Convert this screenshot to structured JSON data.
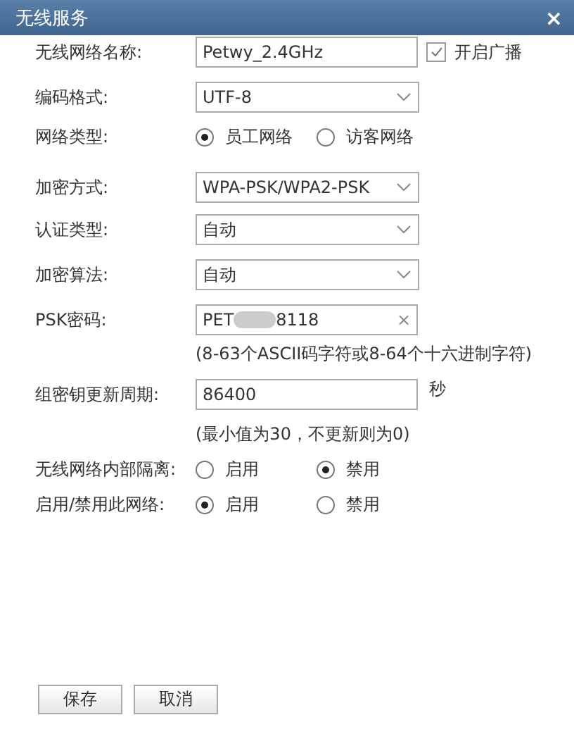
{
  "window": {
    "title": "无线服务",
    "close": "×"
  },
  "rows": [
    {
      "kind": "text",
      "label": "无线网络名称:",
      "value": "Petwy_2.4GHz",
      "checkbox": {
        "label": "开启广播",
        "checked": true
      }
    },
    {
      "kind": "select",
      "label": "编码格式:",
      "value": "UTF-8"
    },
    {
      "kind": "radio",
      "label": "网络类型:",
      "options": [
        {
          "label": "员工网络",
          "selected": true
        },
        {
          "label": "访客网络",
          "selected": false
        }
      ]
    },
    {
      "kind": "select",
      "label": "加密方式:",
      "value": "WPA-PSK/WPA2-PSK"
    },
    {
      "kind": "select",
      "label": "认证类型:",
      "value": "自动"
    },
    {
      "kind": "select",
      "label": "加密算法:",
      "value": "自动"
    },
    {
      "kind": "password",
      "label": "PSK密码:",
      "value_start": "PET",
      "value_end": "8118",
      "clear": "×"
    },
    {
      "kind": "hint",
      "text": "(8-63个ASCII码字符或8-64个十六进制字符)"
    },
    {
      "kind": "text",
      "label": "组密钥更新周期:",
      "value": "86400",
      "unit": "秒"
    },
    {
      "kind": "hint",
      "text": "(最小值为30，不更新则为0)"
    },
    {
      "kind": "radio",
      "label": "无线网络内部隔离:",
      "options": [
        {
          "label": "启用",
          "selected": false
        },
        {
          "label": "禁用",
          "selected": true
        }
      ]
    },
    {
      "kind": "radio",
      "label": "启用/禁用此网络:",
      "options": [
        {
          "label": "启用",
          "selected": true
        },
        {
          "label": "禁用",
          "selected": false
        }
      ]
    }
  ],
  "buttons": [
    "保存",
    "取消"
  ]
}
